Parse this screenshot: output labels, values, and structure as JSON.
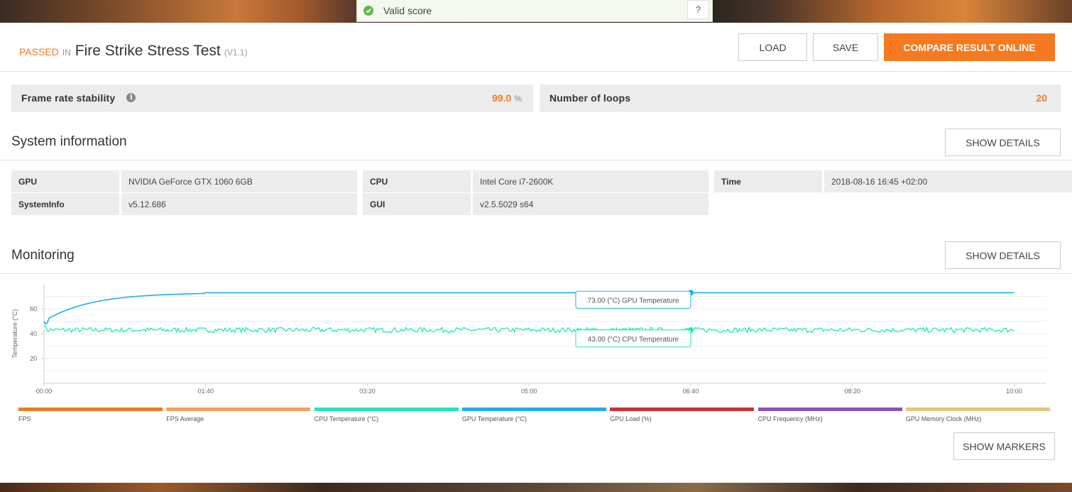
{
  "toast": {
    "label": "Valid score",
    "help": "?"
  },
  "header": {
    "status": "PASSED",
    "in": "IN",
    "test_name": "Fire Strike Stress Test",
    "version": "(V1.1)",
    "load_label": "LOAD",
    "save_label": "SAVE",
    "compare_label": "COMPARE RESULT ONLINE"
  },
  "stats": {
    "frame_rate_label": "Frame rate stability",
    "frame_rate_value": "99.0",
    "frame_rate_unit": "%",
    "loops_label": "Number of loops",
    "loops_value": "20"
  },
  "system": {
    "title": "System information",
    "details_label": "SHOW DETAILS",
    "rows": [
      {
        "key": "GPU",
        "value": "NVIDIA GeForce GTX 1060 6GB"
      },
      {
        "key": "SystemInfo",
        "value": "v5.12.686"
      },
      {
        "key": "CPU",
        "value": "Intel Core i7-2600K"
      },
      {
        "key": "GUI",
        "value": "v2.5.5029 s64"
      },
      {
        "key": "Time",
        "value": "2018-08-16 16:45 +02:00"
      }
    ]
  },
  "monitoring": {
    "title": "Monitoring",
    "details_label": "SHOW DETAILS",
    "markers_label": "SHOW MARKERS",
    "tooltip_gpu": "73.00 (°C) GPU Temperature",
    "tooltip_cpu": "43.00 (°C) CPU Temperature",
    "legend": [
      {
        "label": "FPS",
        "color": "#f07a22"
      },
      {
        "label": "FPS Average",
        "color": "#f5a05c"
      },
      {
        "label": "CPU Temperature (°C)",
        "color": "#1de9b6"
      },
      {
        "label": "GPU Temperature (°C)",
        "color": "#1ab0f0"
      },
      {
        "label": "GPU Load (%)",
        "color": "#d32f2f"
      },
      {
        "label": "CPU Frequency (MHz)",
        "color": "#8e4fc0"
      },
      {
        "label": "GPU Memory Clock (MHz)",
        "color": "#e0c87a"
      }
    ]
  },
  "chart_data": {
    "type": "line",
    "ylabel": "Temperature (°C)",
    "xlabel": "",
    "ylim": [
      0,
      80
    ],
    "yticks": [
      "20",
      "40",
      "60"
    ],
    "xticks": [
      "00:00",
      "01:40",
      "03:20",
      "05:00",
      "06:40",
      "08:20",
      "10:00"
    ],
    "grid": true,
    "series": [
      {
        "name": "GPU Temperature (°C)",
        "color": "#1ab0f0",
        "shape": "warmup_then_plateau",
        "start": 50,
        "plateau": 73,
        "end_time": "10:00"
      },
      {
        "name": "CPU Temperature (°C)",
        "color": "#1de9b6",
        "shape": "noisy_flat",
        "mean": 43,
        "noise": 2,
        "end_time": "10:00"
      }
    ],
    "cursor": {
      "time": "06:40",
      "gpu": 73.0,
      "cpu": 43.0
    }
  }
}
